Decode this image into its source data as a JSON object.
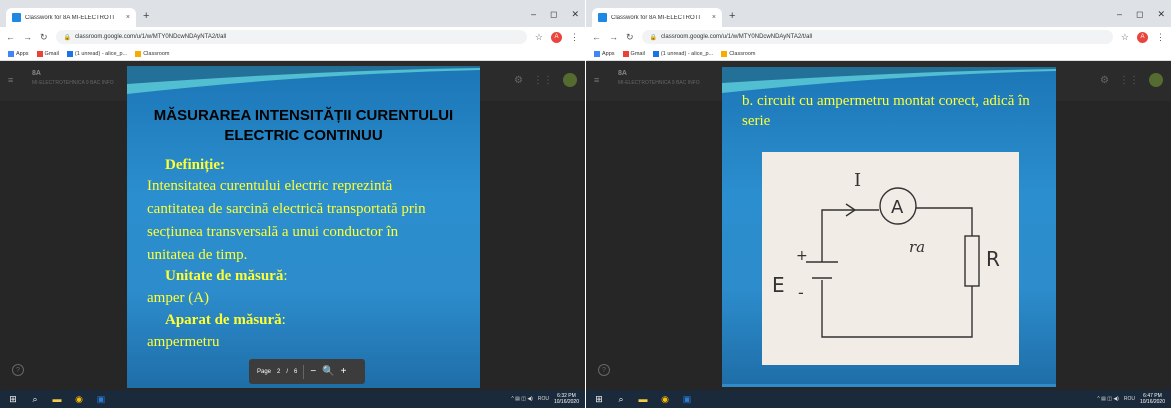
{
  "left": {
    "tab_title": "Classwork for 8A MI-ELECTROTI",
    "url": "classroom.google.com/u/1/w/MTY0NDcwNDAyNTA2/t/all",
    "bookmarks": [
      "Apps",
      "Gmail",
      "(1 unread) - alice_p...",
      "Classroom"
    ],
    "class_name": "8A",
    "class_sub": "MI-ELECTROTEHNICA 9 BAC INFO",
    "slide": {
      "title_line1": "MĂSURAREA INTENSITĂȚII CURENTULUI",
      "title_line2": "ELECTRIC CONTINUU",
      "def_label": "Definiție:",
      "def_text": [
        "Intensitatea curentului electric reprezintă",
        "cantitatea de sarcină electrică transportată prin",
        "secțiunea transversală a unui conductor în",
        "unitatea de timp."
      ],
      "unit_label": "Unitate de măsură",
      "unit_colon": ":",
      "unit_value": "amper (A)",
      "device_label": "Aparat de măsură",
      "device_colon": ":",
      "device_value": "ampermetru"
    },
    "pagebar": {
      "page_label": "Page",
      "current": "2",
      "sep": "/",
      "total": "6"
    },
    "taskbar": {
      "lang": "ROU",
      "time": "6:32 PM",
      "date": "10/16/2020"
    }
  },
  "right": {
    "tab_title": "Classwork for 8A MI-ELECTROTI",
    "url": "classroom.google.com/u/1/w/MTY0NDcwNDAyNTA2/t/all",
    "bookmarks": [
      "Apps",
      "Gmail",
      "(1 unread) - alice_p...",
      "Classroom"
    ],
    "class_name": "8A",
    "class_sub": "MI-ELECTROTEHNICA 9 BAC INFO",
    "slide_text": "b. circuit cu ampermetru montat corect, adică în serie",
    "drawing_labels": {
      "current": "I",
      "ammeter": "A",
      "ra": "ra",
      "resistor": "R",
      "emf": "E",
      "plus": "+",
      "minus": "-"
    },
    "taskbar": {
      "lang": "ROU",
      "time": "6:47 PM",
      "date": "10/16/2020"
    }
  },
  "colors": {
    "slide_blue": "#2b8ece",
    "slide_yellow": "#ffff33",
    "taskbar": "#1a2a3a"
  }
}
